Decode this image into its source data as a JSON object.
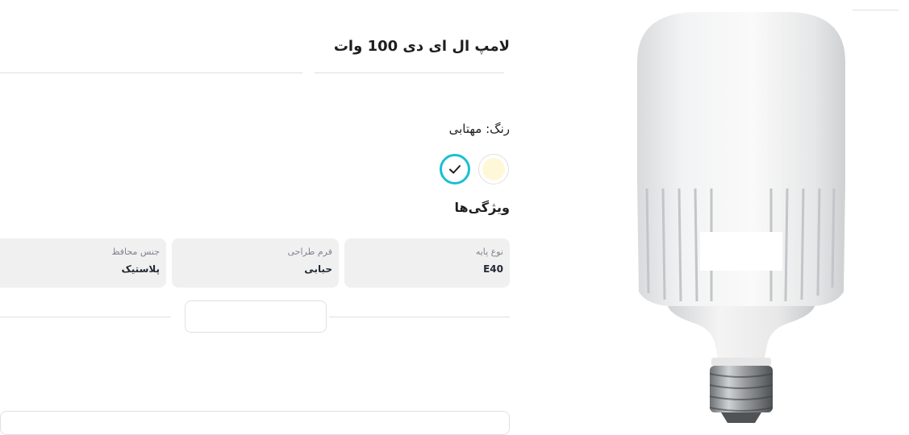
{
  "product": {
    "title": "لامپ ال ای دی 100 وات",
    "color_label": "رنگ: مهتابی",
    "colors": [
      {
        "name": "مهتابی",
        "hex": "#ffffff",
        "selected": true
      },
      {
        "name": "آفتابی",
        "hex": "#fff8d8",
        "selected": false
      }
    ],
    "features_title": "ویژگی‌ها",
    "specs": [
      {
        "key": "نوع پایه",
        "value": "E40"
      },
      {
        "key": "فرم طراحی",
        "value": "حبابی"
      },
      {
        "key": "جنس محافظ",
        "value": "پلاستیک"
      }
    ]
  },
  "theme": {
    "accent": "#19bfd3",
    "spec_bg": "#f0f0f1"
  },
  "icons": {
    "selected_check": "check-icon"
  }
}
